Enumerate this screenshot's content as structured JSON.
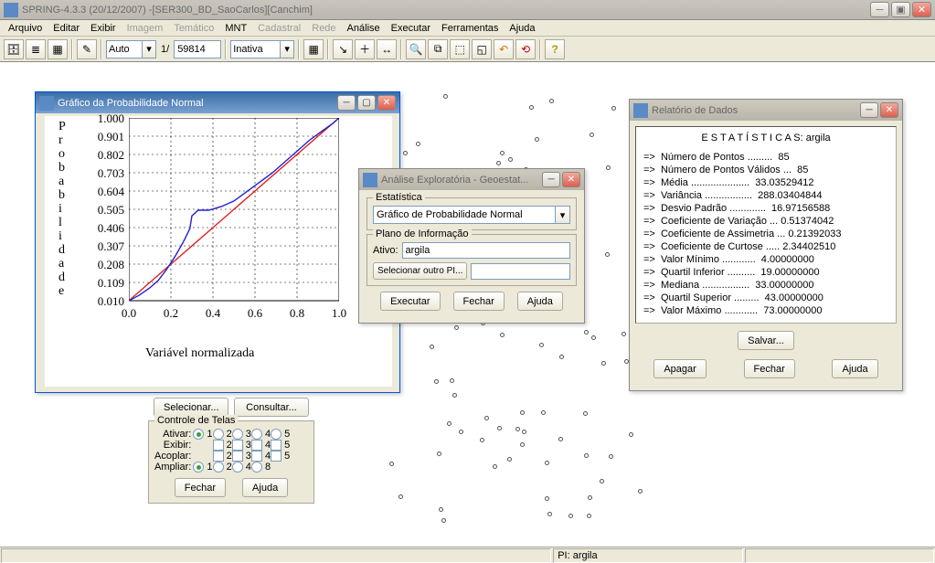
{
  "app": {
    "title": "SPRING-4.3.3 (20/12/2007) -[SER300_BD_SaoCarlos][Canchim]"
  },
  "menu": {
    "arquivo": "Arquivo",
    "editar": "Editar",
    "exibir": "Exibir",
    "imagem": "Imagem",
    "tematico": "Temático",
    "mnt": "MNT",
    "cadastral": "Cadastral",
    "rede": "Rede",
    "analise": "Análise",
    "executar": "Executar",
    "ferramentas": "Ferramentas",
    "ajuda": "Ajuda"
  },
  "toolbar": {
    "auto": "Auto",
    "scale_prefix": "1/",
    "scale_value": "59814",
    "inativa": "Inativa"
  },
  "dialogs": {
    "normal_plot": {
      "title": "Gráfico da Probabilidade Normal"
    },
    "analise": {
      "title": "Análise Exploratória - Geoestat...",
      "grp_stat": "Estatística",
      "combo_value": "Gráfico de Probabilidade Normal",
      "grp_plano": "Plano de Informação",
      "ativo_label": "Ativo:",
      "ativo_value": "argila",
      "selecionar_outro": "Selecionar outro PI...",
      "executar": "Executar",
      "fechar": "Fechar",
      "ajuda": "Ajuda"
    },
    "relatorio": {
      "title": "Relatório de Dados",
      "header": "E S T A T Í S T I C A S: argila",
      "lines": [
        "=>  Número de Pontos .........  85",
        "=>  Número de Pontos Válidos ...  85",
        "=>  Média .....................  33.03529412",
        "=>  Variância .................  288.03404844",
        "=>  Desvio Padrão .............  16.97156588",
        "=>  Coeficiente de Variação ... 0.51374042",
        "=>  Coeficiente de Assimetria ... 0.21392033",
        "=>  Coeficiente de Curtose ..... 2.34402510",
        "=>  Valor Mínimo ............  4.00000000",
        "=>  Quartil Inferior ..........  19.00000000",
        "=>  Mediana .................  33.00000000",
        "=>  Quartil Superior .........  43.00000000",
        "=>  Valor Máximo ............  73.00000000"
      ],
      "salvar": "Salvar...",
      "apagar": "Apagar",
      "fechar": "Fechar",
      "ajuda": "Ajuda"
    }
  },
  "panel": {
    "selecionar": "Selecionar...",
    "consultar": "Consultar...",
    "controle_title": "Controle de Telas",
    "ativar": "Ativar:",
    "exibir": "Exibir:",
    "acoplar": "Acoplar:",
    "ampliar": "Ampliar:",
    "fechar": "Fechar",
    "ajuda": "Ajuda",
    "cols": [
      "1",
      "2",
      "3",
      "4",
      "5"
    ],
    "ampliar_cols": [
      "1",
      "2",
      "4",
      "8"
    ]
  },
  "chart_data": {
    "type": "line",
    "title": "Gráfico da Probabilidade Normal",
    "xlabel": "Variável normalizada",
    "ylabel": "Probabilidade",
    "ylabel_chars": [
      "P",
      "r",
      "o",
      "b",
      "a",
      "b",
      "i",
      "l",
      "i",
      "d",
      "a",
      "d",
      "e"
    ],
    "x_ticks": [
      0.0,
      0.2,
      0.4,
      0.6,
      0.8,
      1.0
    ],
    "y_ticks": [
      0.01,
      0.109,
      0.208,
      0.307,
      0.406,
      0.505,
      0.604,
      0.703,
      0.802,
      0.901,
      1.0
    ],
    "xlim": [
      0.0,
      1.0
    ],
    "ylim": [
      0.01,
      1.0
    ],
    "series": [
      {
        "name": "reference",
        "color": "#e02020",
        "x": [
          0.0,
          1.0
        ],
        "y": [
          0.01,
          1.0
        ]
      },
      {
        "name": "empirical",
        "color": "#2020d0",
        "x": [
          0.0,
          0.05,
          0.1,
          0.14,
          0.18,
          0.22,
          0.26,
          0.29,
          0.3,
          0.33,
          0.38,
          0.44,
          0.5,
          0.56,
          0.62,
          0.68,
          0.74,
          0.8,
          0.86,
          0.92,
          0.97,
          1.0
        ],
        "y": [
          0.01,
          0.04,
          0.08,
          0.12,
          0.18,
          0.25,
          0.33,
          0.4,
          0.47,
          0.5,
          0.5,
          0.52,
          0.55,
          0.6,
          0.65,
          0.7,
          0.76,
          0.82,
          0.88,
          0.93,
          0.97,
          1.0
        ]
      }
    ]
  },
  "statusbar": {
    "pi": "PI: argila"
  }
}
